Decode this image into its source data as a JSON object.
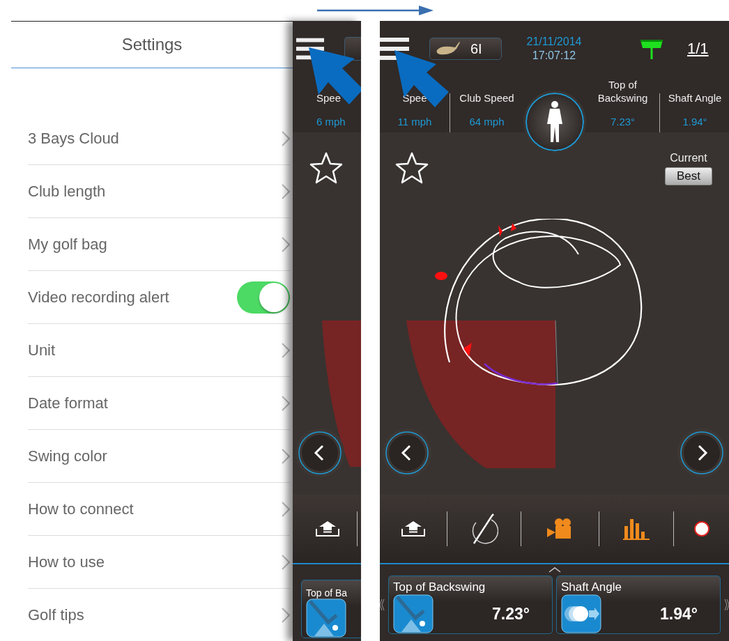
{
  "settings": {
    "title": "Settings",
    "items": [
      {
        "label": "3 Bays Cloud",
        "kind": "link"
      },
      {
        "label": "Club length",
        "kind": "link"
      },
      {
        "label": "My golf bag",
        "kind": "link"
      },
      {
        "label": "Video recording alert",
        "kind": "toggle",
        "on": true
      },
      {
        "label": "Unit",
        "kind": "link"
      },
      {
        "label": "Date format",
        "kind": "link"
      },
      {
        "label": "Swing color",
        "kind": "link"
      },
      {
        "label": "How to connect",
        "kind": "link"
      },
      {
        "label": "How to use",
        "kind": "link"
      },
      {
        "label": "Golf tips",
        "kind": "link"
      }
    ]
  },
  "behind_phone": {
    "metric_label": "Spee",
    "metric_value": "6 mph",
    "favorite": false,
    "card_title": "Top of Ba"
  },
  "phone": {
    "club": "6I",
    "date": "21/11/2014",
    "time": "17:07:12",
    "page": "1/1",
    "metrics": [
      {
        "label": "Spee",
        "value": "11 mph"
      },
      {
        "label": "Club Speed",
        "value": "64 mph"
      },
      {
        "label": "Top of Backswing",
        "value": "7.23°"
      },
      {
        "label": "Shaft Angle",
        "value": "1.94°"
      }
    ],
    "favorite": false,
    "current_label": "Current",
    "best_label": "Best",
    "toolbar": [
      {
        "kind": "upload",
        "active": false
      },
      {
        "kind": "swing",
        "active": false
      },
      {
        "kind": "video",
        "active": true
      },
      {
        "kind": "stats",
        "active": true
      },
      {
        "kind": "record",
        "active": false
      }
    ],
    "cards": [
      {
        "kind": "club",
        "title": "Top of Backswing",
        "value": "7.23°"
      },
      {
        "kind": "shaft",
        "title": "Shaft Angle",
        "value": "1.94°"
      }
    ]
  }
}
